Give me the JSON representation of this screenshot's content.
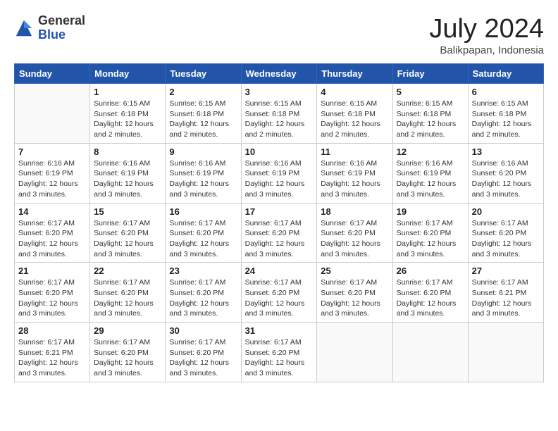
{
  "header": {
    "logo_general": "General",
    "logo_blue": "Blue",
    "month": "July 2024",
    "location": "Balikpapan, Indonesia"
  },
  "days_of_week": [
    "Sunday",
    "Monday",
    "Tuesday",
    "Wednesday",
    "Thursday",
    "Friday",
    "Saturday"
  ],
  "weeks": [
    [
      {
        "day": "",
        "info": ""
      },
      {
        "day": "1",
        "info": "Sunrise: 6:15 AM\nSunset: 6:18 PM\nDaylight: 12 hours\nand 2 minutes."
      },
      {
        "day": "2",
        "info": "Sunrise: 6:15 AM\nSunset: 6:18 PM\nDaylight: 12 hours\nand 2 minutes."
      },
      {
        "day": "3",
        "info": "Sunrise: 6:15 AM\nSunset: 6:18 PM\nDaylight: 12 hours\nand 2 minutes."
      },
      {
        "day": "4",
        "info": "Sunrise: 6:15 AM\nSunset: 6:18 PM\nDaylight: 12 hours\nand 2 minutes."
      },
      {
        "day": "5",
        "info": "Sunrise: 6:15 AM\nSunset: 6:18 PM\nDaylight: 12 hours\nand 2 minutes."
      },
      {
        "day": "6",
        "info": "Sunrise: 6:15 AM\nSunset: 6:18 PM\nDaylight: 12 hours\nand 2 minutes."
      }
    ],
    [
      {
        "day": "7",
        "info": "Sunrise: 6:16 AM\nSunset: 6:19 PM\nDaylight: 12 hours\nand 3 minutes."
      },
      {
        "day": "8",
        "info": "Sunrise: 6:16 AM\nSunset: 6:19 PM\nDaylight: 12 hours\nand 3 minutes."
      },
      {
        "day": "9",
        "info": "Sunrise: 6:16 AM\nSunset: 6:19 PM\nDaylight: 12 hours\nand 3 minutes."
      },
      {
        "day": "10",
        "info": "Sunrise: 6:16 AM\nSunset: 6:19 PM\nDaylight: 12 hours\nand 3 minutes."
      },
      {
        "day": "11",
        "info": "Sunrise: 6:16 AM\nSunset: 6:19 PM\nDaylight: 12 hours\nand 3 minutes."
      },
      {
        "day": "12",
        "info": "Sunrise: 6:16 AM\nSunset: 6:19 PM\nDaylight: 12 hours\nand 3 minutes."
      },
      {
        "day": "13",
        "info": "Sunrise: 6:16 AM\nSunset: 6:20 PM\nDaylight: 12 hours\nand 3 minutes."
      }
    ],
    [
      {
        "day": "14",
        "info": "Sunrise: 6:17 AM\nSunset: 6:20 PM\nDaylight: 12 hours\nand 3 minutes."
      },
      {
        "day": "15",
        "info": "Sunrise: 6:17 AM\nSunset: 6:20 PM\nDaylight: 12 hours\nand 3 minutes."
      },
      {
        "day": "16",
        "info": "Sunrise: 6:17 AM\nSunset: 6:20 PM\nDaylight: 12 hours\nand 3 minutes."
      },
      {
        "day": "17",
        "info": "Sunrise: 6:17 AM\nSunset: 6:20 PM\nDaylight: 12 hours\nand 3 minutes."
      },
      {
        "day": "18",
        "info": "Sunrise: 6:17 AM\nSunset: 6:20 PM\nDaylight: 12 hours\nand 3 minutes."
      },
      {
        "day": "19",
        "info": "Sunrise: 6:17 AM\nSunset: 6:20 PM\nDaylight: 12 hours\nand 3 minutes."
      },
      {
        "day": "20",
        "info": "Sunrise: 6:17 AM\nSunset: 6:20 PM\nDaylight: 12 hours\nand 3 minutes."
      }
    ],
    [
      {
        "day": "21",
        "info": "Sunrise: 6:17 AM\nSunset: 6:20 PM\nDaylight: 12 hours\nand 3 minutes."
      },
      {
        "day": "22",
        "info": "Sunrise: 6:17 AM\nSunset: 6:20 PM\nDaylight: 12 hours\nand 3 minutes."
      },
      {
        "day": "23",
        "info": "Sunrise: 6:17 AM\nSunset: 6:20 PM\nDaylight: 12 hours\nand 3 minutes."
      },
      {
        "day": "24",
        "info": "Sunrise: 6:17 AM\nSunset: 6:20 PM\nDaylight: 12 hours\nand 3 minutes."
      },
      {
        "day": "25",
        "info": "Sunrise: 6:17 AM\nSunset: 6:20 PM\nDaylight: 12 hours\nand 3 minutes."
      },
      {
        "day": "26",
        "info": "Sunrise: 6:17 AM\nSunset: 6:20 PM\nDaylight: 12 hours\nand 3 minutes."
      },
      {
        "day": "27",
        "info": "Sunrise: 6:17 AM\nSunset: 6:21 PM\nDaylight: 12 hours\nand 3 minutes."
      }
    ],
    [
      {
        "day": "28",
        "info": "Sunrise: 6:17 AM\nSunset: 6:21 PM\nDaylight: 12 hours\nand 3 minutes."
      },
      {
        "day": "29",
        "info": "Sunrise: 6:17 AM\nSunset: 6:20 PM\nDaylight: 12 hours\nand 3 minutes."
      },
      {
        "day": "30",
        "info": "Sunrise: 6:17 AM\nSunset: 6:20 PM\nDaylight: 12 hours\nand 3 minutes."
      },
      {
        "day": "31",
        "info": "Sunrise: 6:17 AM\nSunset: 6:20 PM\nDaylight: 12 hours\nand 3 minutes."
      },
      {
        "day": "",
        "info": ""
      },
      {
        "day": "",
        "info": ""
      },
      {
        "day": "",
        "info": ""
      }
    ]
  ]
}
